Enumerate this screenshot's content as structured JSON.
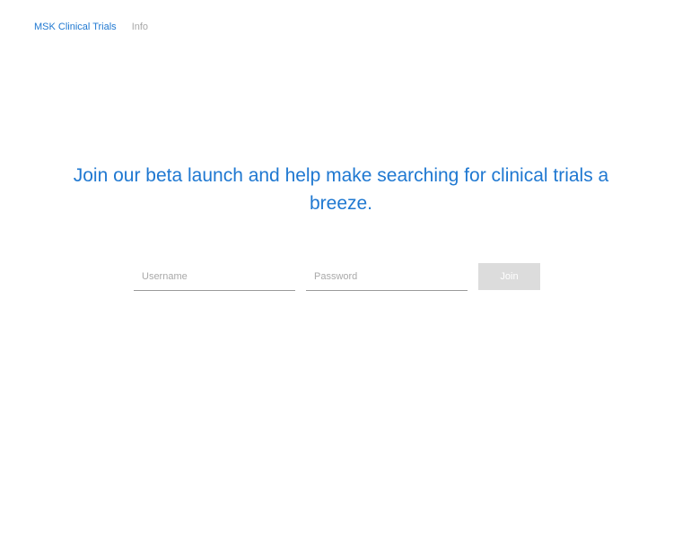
{
  "nav": {
    "brand_label": "MSK Clinical Trials",
    "info_label": "Info"
  },
  "hero": {
    "headline": "Join our beta launch and help make searching for clinical trials a breeze."
  },
  "form": {
    "username": {
      "value": "",
      "placeholder": "Username"
    },
    "password": {
      "value": "",
      "placeholder": "Password"
    },
    "join_label": "Join"
  },
  "colors": {
    "accent": "#1f78d1",
    "muted_nav": "#a8a8a8",
    "button_disabled_bg": "#dcdcdc"
  }
}
